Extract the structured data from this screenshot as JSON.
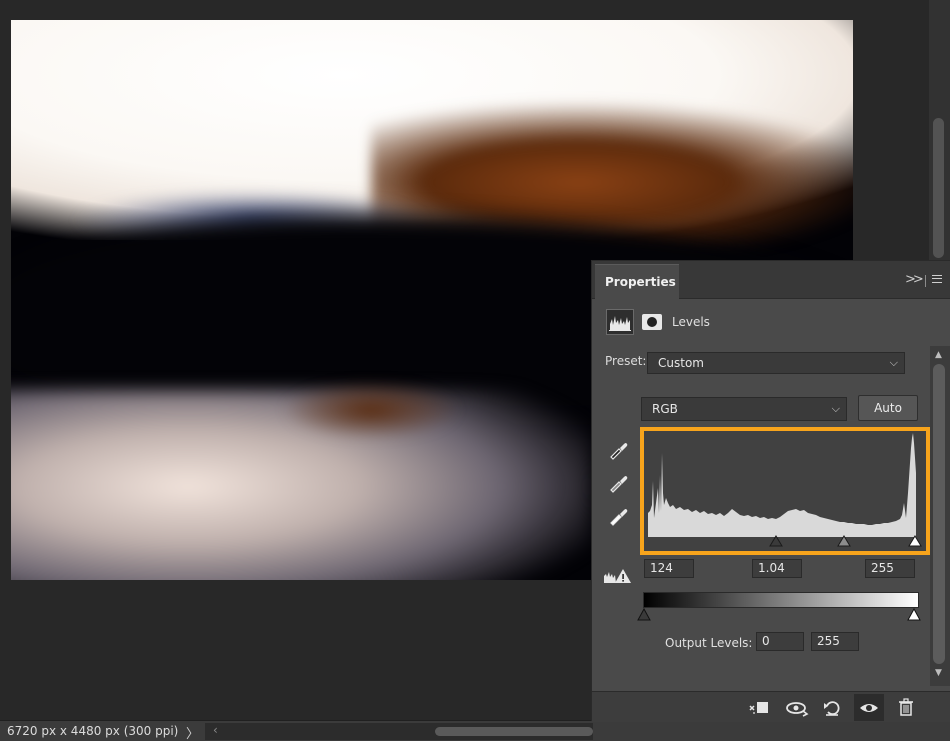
{
  "document": {
    "status_info": "6720 px x 4480 px (300 ppi)",
    "status_arrow": "〉",
    "scroll_left_arrow": "‹"
  },
  "panel": {
    "tab_title": "Properties",
    "collapse_glyph": "»",
    "adjustment_title": "Levels",
    "preset_label": "Preset:",
    "preset_value": "Custom",
    "channel_value": "RGB",
    "auto_label": "Auto",
    "input_levels": {
      "black": "124",
      "gamma": "1.04",
      "white": "255"
    },
    "output_label": "Output Levels:",
    "output_levels": {
      "black": "0",
      "white": "255"
    },
    "highlight_color": "#f7a41c",
    "bottom_icons": [
      "clip-to-layer-icon",
      "view-previous-state-icon",
      "reset-icon",
      "visibility-eye-icon",
      "trash-icon"
    ]
  }
}
